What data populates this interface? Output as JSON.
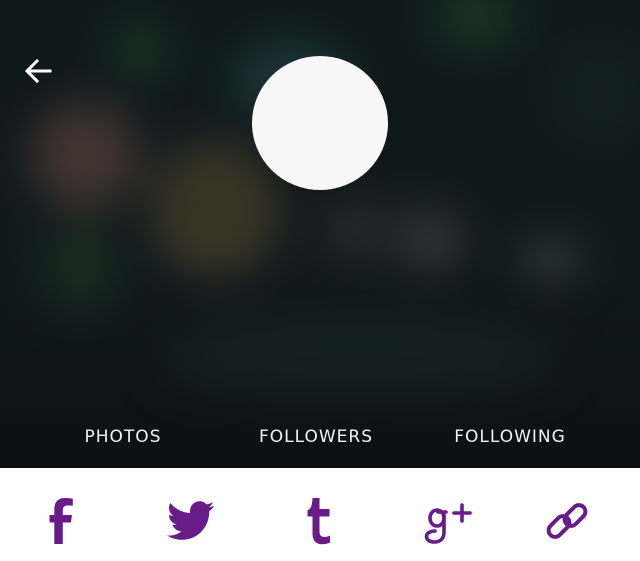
{
  "header": {
    "stats": {
      "photos_label": "PHOTOS",
      "followers_label": "FOLLOWERS",
      "following_label": "FOLLOWING"
    },
    "back_icon": "arrow-left-icon",
    "avatar": "avatar-placeholder"
  },
  "share_bar": {
    "accent_color": "#6a1b8a",
    "items": [
      {
        "icon": "facebook-icon"
      },
      {
        "icon": "twitter-icon"
      },
      {
        "icon": "tumblr-icon"
      },
      {
        "icon": "google-plus-icon"
      },
      {
        "icon": "link-icon"
      }
    ]
  }
}
